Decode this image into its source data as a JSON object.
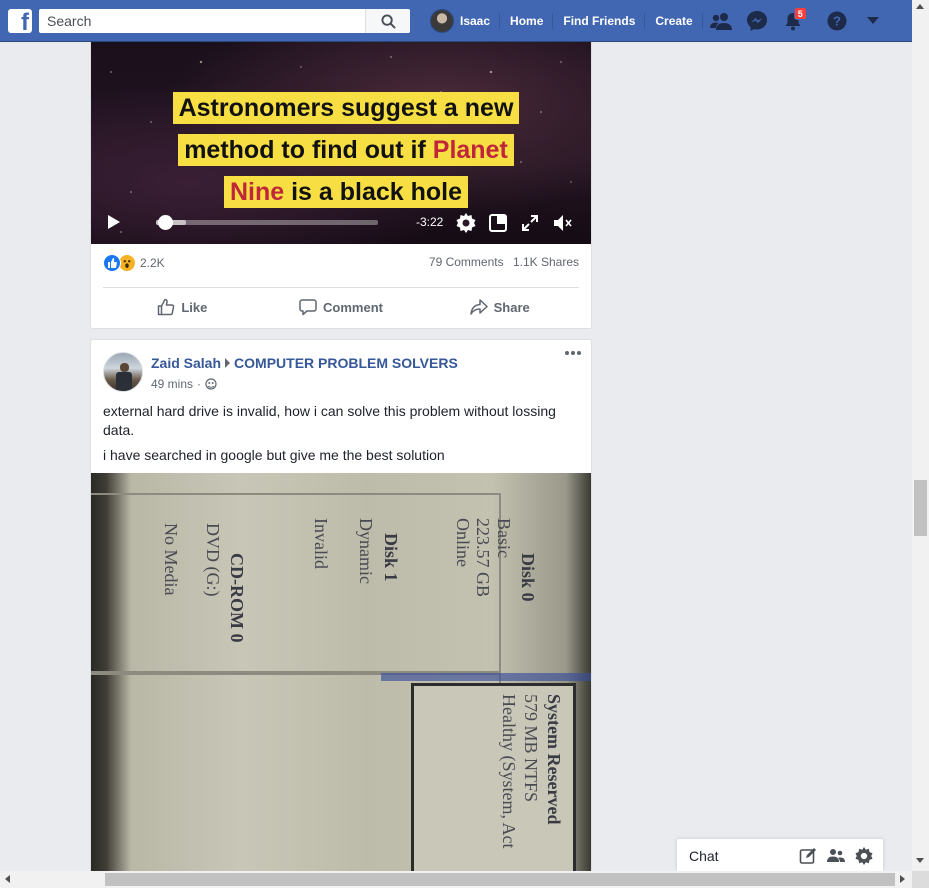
{
  "topbar": {
    "search_placeholder": "Search",
    "user_name": "Isaac",
    "nav": [
      "Home",
      "Find Friends",
      "Create"
    ],
    "notifications_count": "5"
  },
  "post1": {
    "headline_line1": "Astronomers suggest a new",
    "headline_line2_pre": "method to find out if ",
    "headline_line2_red": "Planet",
    "headline_line3_red": "Nine",
    "headline_line3_post": " is a black hole",
    "video_time": "-3:22",
    "video_progress": 0.02,
    "reaction_count": "2.2K",
    "comments": "79 Comments",
    "shares": "1.1K Shares",
    "actions": {
      "like": "Like",
      "comment": "Comment",
      "share": "Share"
    }
  },
  "post2": {
    "author": "Zaid Salah",
    "group": "COMPUTER PROBLEM SOLVERS",
    "time": "49 mins",
    "text_line1": "external hard drive is invalid, how i can solve this problem without lossing data.",
    "text_line2": "i have searched in google but give me the best solution",
    "photo": {
      "disk0_title": "Disk 0",
      "disk0_type": "Basic",
      "disk0_size": "223.57 GB",
      "disk0_status": "Online",
      "disk1_title": "Disk 1",
      "disk1_type": "Dynamic",
      "disk1_status": "Invalid",
      "cdrom_title": "CD-ROM 0",
      "cdrom_drive": "DVD (G:)",
      "cdrom_status": "No Media",
      "sys_title": "System Reserved",
      "sys_size": "579 MB NTFS",
      "sys_status": "Healthy (System, Act"
    }
  },
  "chat": {
    "label": "Chat"
  },
  "colors": {
    "brand": "#4267b2",
    "link": "#365899",
    "highlight": "#f7df43",
    "red_text": "#c0263a"
  }
}
